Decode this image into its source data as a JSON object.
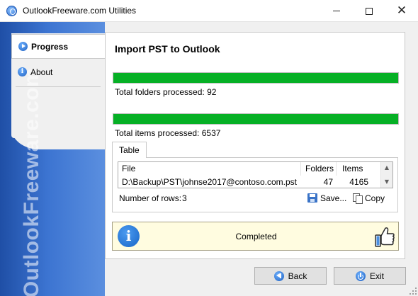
{
  "window": {
    "title": "OutlookFreeware.com Utilities",
    "minimize_icon": "minimize-icon",
    "maximize_icon": "maximize-icon",
    "close_icon": "close-icon"
  },
  "sidebar": {
    "brand_text": "OutlookFreeware.com",
    "items": [
      {
        "label": "Progress",
        "icon": "play-icon",
        "active": true
      },
      {
        "label": "About",
        "icon": "info-icon",
        "active": false
      }
    ]
  },
  "main": {
    "title": "Import PST to Outlook",
    "progress": [
      {
        "label": "Total folders processed: 92",
        "fraction": 1.0,
        "color": "#06b025"
      },
      {
        "label": "Total items processed: 6537",
        "fraction": 1.0,
        "color": "#06b025"
      }
    ],
    "tab": {
      "label": "Table",
      "table": {
        "columns": [
          "File",
          "Folders",
          "Items"
        ],
        "rows": [
          [
            "D:\\Backup\\PST\\johnse2017@contoso.com.pst",
            "47",
            "4165"
          ]
        ]
      },
      "rows_label": "Number of rows:",
      "rows_value": "3",
      "save_label": "Save...",
      "copy_label": "Copy"
    },
    "status": {
      "text": "Completed",
      "info_icon": "info-icon",
      "thumb_icon": "thumbs-up-icon",
      "background": "#fffce0"
    }
  },
  "footer": {
    "back_label": "Back",
    "exit_label": "Exit"
  }
}
